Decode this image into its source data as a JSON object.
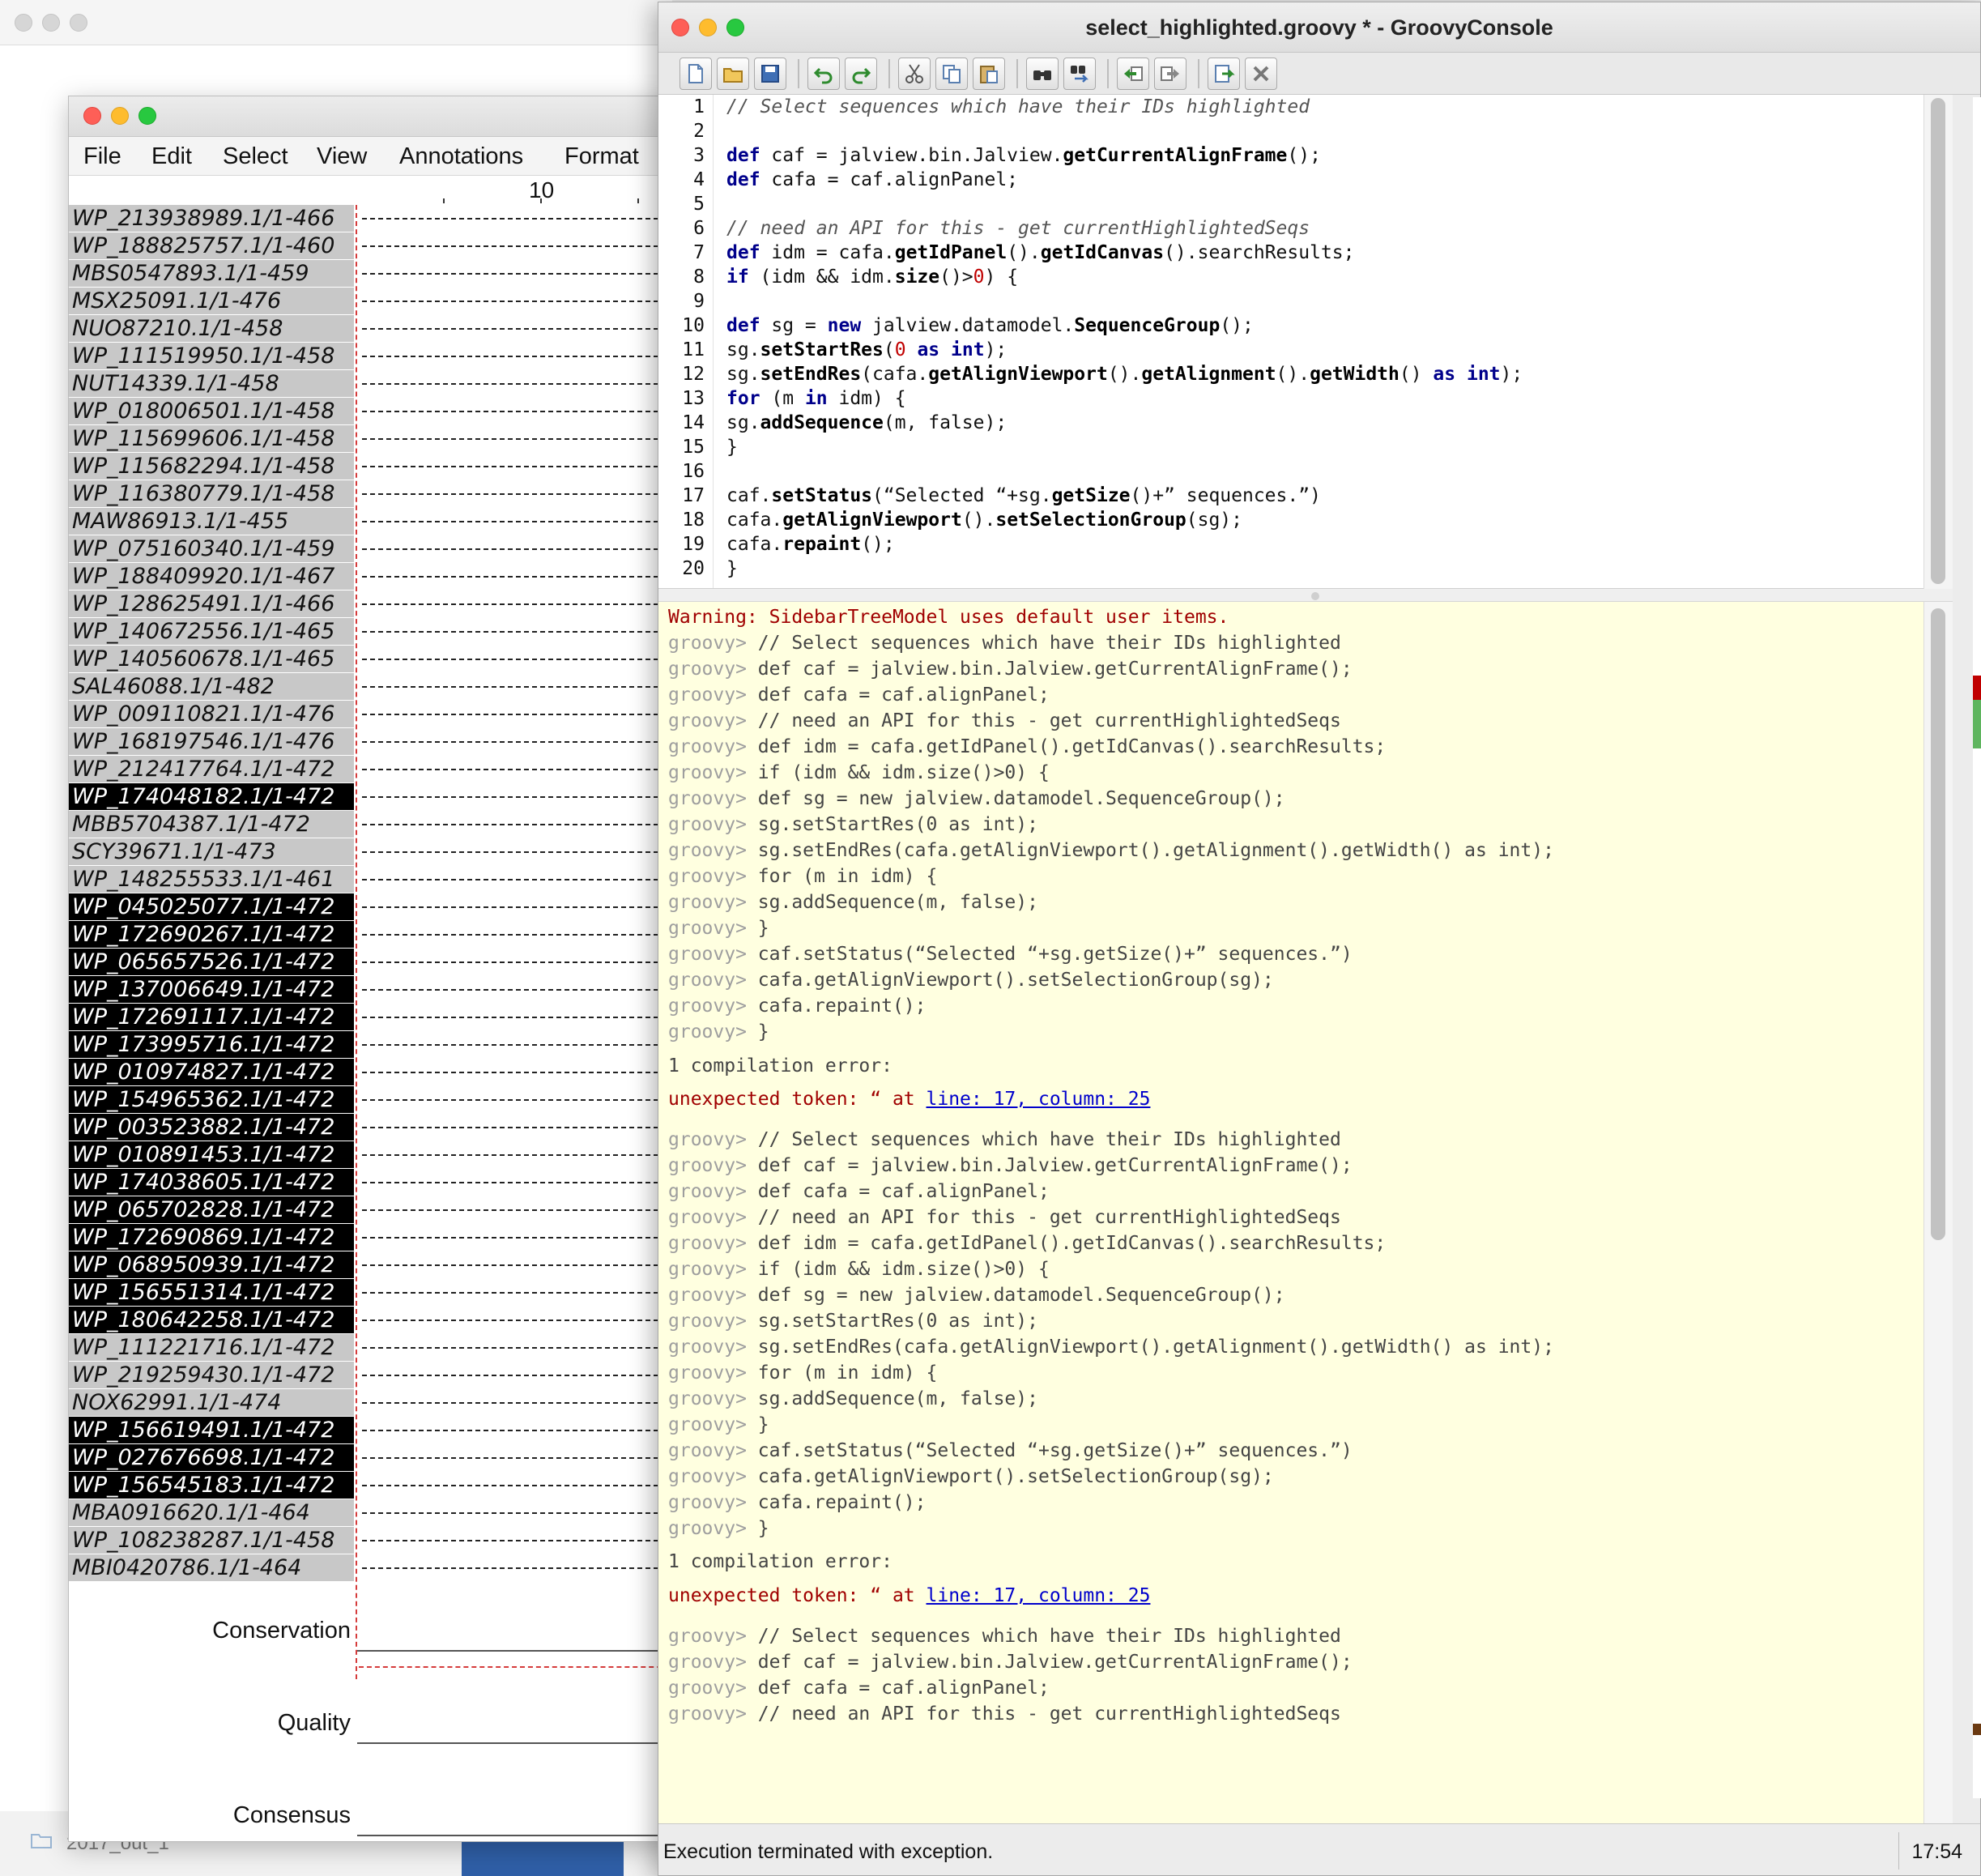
{
  "desktop": {
    "folder_label": "2017_out_1"
  },
  "jalview": {
    "menu": [
      "File",
      "Edit",
      "Select",
      "View",
      "Annotations",
      "Format"
    ],
    "ruler_label": "10",
    "sequences": [
      {
        "id": "WP_213938989.1/1-466",
        "hl": false
      },
      {
        "id": "WP_188825757.1/1-460",
        "hl": false
      },
      {
        "id": "MBS0547893.1/1-459",
        "hl": false
      },
      {
        "id": "MSX25091.1/1-476",
        "hl": false
      },
      {
        "id": "NUO87210.1/1-458",
        "hl": false
      },
      {
        "id": "WP_111519950.1/1-458",
        "hl": false
      },
      {
        "id": "NUT14339.1/1-458",
        "hl": false
      },
      {
        "id": "WP_018006501.1/1-458",
        "hl": false
      },
      {
        "id": "WP_115699606.1/1-458",
        "hl": false
      },
      {
        "id": "WP_115682294.1/1-458",
        "hl": false
      },
      {
        "id": "WP_116380779.1/1-458",
        "hl": false
      },
      {
        "id": "MAW86913.1/1-455",
        "hl": false
      },
      {
        "id": "WP_075160340.1/1-459",
        "hl": false
      },
      {
        "id": "WP_188409920.1/1-467",
        "hl": false
      },
      {
        "id": "WP_128625491.1/1-466",
        "hl": false
      },
      {
        "id": "WP_140672556.1/1-465",
        "hl": false
      },
      {
        "id": "WP_140560678.1/1-465",
        "hl": false
      },
      {
        "id": "SAL46088.1/1-482",
        "hl": false
      },
      {
        "id": "WP_009110821.1/1-476",
        "hl": false
      },
      {
        "id": "WP_168197546.1/1-476",
        "hl": false
      },
      {
        "id": "WP_212417764.1/1-472",
        "hl": false
      },
      {
        "id": "WP_174048182.1/1-472",
        "hl": true
      },
      {
        "id": "MBB5704387.1/1-472",
        "hl": false
      },
      {
        "id": "SCY39671.1/1-473",
        "hl": false
      },
      {
        "id": "WP_148255533.1/1-461",
        "hl": false
      },
      {
        "id": "WP_045025077.1/1-472",
        "hl": true
      },
      {
        "id": "WP_172690267.1/1-472",
        "hl": true
      },
      {
        "id": "WP_065657526.1/1-472",
        "hl": true
      },
      {
        "id": "WP_137006649.1/1-472",
        "hl": true
      },
      {
        "id": "WP_172691117.1/1-472",
        "hl": true
      },
      {
        "id": "WP_173995716.1/1-472",
        "hl": true
      },
      {
        "id": "WP_010974827.1/1-472",
        "hl": true
      },
      {
        "id": "WP_154965362.1/1-472",
        "hl": true
      },
      {
        "id": "WP_003523882.1/1-472",
        "hl": true
      },
      {
        "id": "WP_010891453.1/1-472",
        "hl": true
      },
      {
        "id": "WP_174038605.1/1-472",
        "hl": true
      },
      {
        "id": "WP_065702828.1/1-472",
        "hl": true
      },
      {
        "id": "WP_172690869.1/1-472",
        "hl": true
      },
      {
        "id": "WP_068950939.1/1-472",
        "hl": true
      },
      {
        "id": "WP_156551314.1/1-472",
        "hl": true
      },
      {
        "id": "WP_180642258.1/1-472",
        "hl": true
      },
      {
        "id": "WP_111221716.1/1-472",
        "hl": false
      },
      {
        "id": "WP_219259430.1/1-472",
        "hl": false
      },
      {
        "id": "NOX62991.1/1-474",
        "hl": false
      },
      {
        "id": "WP_156619491.1/1-472",
        "hl": true
      },
      {
        "id": "WP_027676698.1/1-472",
        "hl": true
      },
      {
        "id": "WP_156545183.1/1-472",
        "hl": true
      },
      {
        "id": "MBA0916620.1/1-464",
        "hl": false
      },
      {
        "id": "WP_108238287.1/1-458",
        "hl": false
      },
      {
        "id": "MBI0420786.1/1-464",
        "hl": false
      }
    ],
    "annotations": [
      "Conservation",
      "Quality",
      "Consensus"
    ]
  },
  "groovy": {
    "title": "select_highlighted.groovy * - GroovyConsole",
    "toolbar_icons": [
      "new-file-icon",
      "open-file-icon",
      "save-icon",
      "undo-icon",
      "redo-icon",
      "cut-icon",
      "copy-icon",
      "paste-icon",
      "find-icon",
      "replace-icon",
      "history-back-icon",
      "history-forward-icon",
      "run-icon",
      "interrupt-icon"
    ],
    "code": [
      "// Select sequences which have their IDs highlighted",
      "",
      "def caf = jalview.bin.Jalview.getCurrentAlignFrame();",
      "def cafa = caf.alignPanel;",
      "",
      "// need an API for this - get currentHighlightedSeqs",
      "def idm = cafa.getIdPanel().getIdCanvas().searchResults;",
      "if (idm && idm.size()>0) {",
      "",
      "def sg = new jalview.datamodel.SequenceGroup();",
      "sg.setStartRes(0 as int);",
      "sg.setEndRes(cafa.getAlignViewport().getAlignment().getWidth() as int);",
      "for (m in idm) {",
      "sg.addSequence(m, false);",
      "}",
      "",
      "caf.setStatus(“Selected “+sg.getSize()+” sequences.”)",
      "cafa.getAlignViewport().setSelectionGroup(sg);",
      "cafa.repaint();",
      "}"
    ],
    "output": {
      "warning": "Warning: SidebarTreeModel uses default user items.",
      "prompt": "groovy>",
      "echo": [
        "// Select sequences which have their IDs highlighted",
        "def caf = jalview.bin.Jalview.getCurrentAlignFrame();",
        "def cafa = caf.alignPanel;",
        "// need an API for this - get currentHighlightedSeqs",
        "def idm = cafa.getIdPanel().getIdCanvas().searchResults;",
        "if (idm && idm.size()>0) {",
        "def sg = new jalview.datamodel.SequenceGroup();",
        "sg.setStartRes(0 as int);",
        "sg.setEndRes(cafa.getAlignViewport().getAlignment().getWidth() as int);",
        "for (m in idm) {",
        "sg.addSequence(m, false);",
        "}",
        "caf.setStatus(“Selected “+sg.getSize()+” sequences.”)",
        "cafa.getAlignViewport().setSelectionGroup(sg);",
        "cafa.repaint();",
        "}"
      ],
      "echo_partial": [
        "// Select sequences which have their IDs highlighted",
        "def caf = jalview.bin.Jalview.getCurrentAlignFrame();",
        "def cafa = caf.alignPanel;",
        "// need an API for this - get currentHighlightedSeqs"
      ],
      "compile_error": "1 compilation error:",
      "token_error": "unexpected token: “ at ",
      "token_link": "line: 17, column: 25"
    },
    "status": "Execution terminated with exception.",
    "time": "17:54"
  }
}
